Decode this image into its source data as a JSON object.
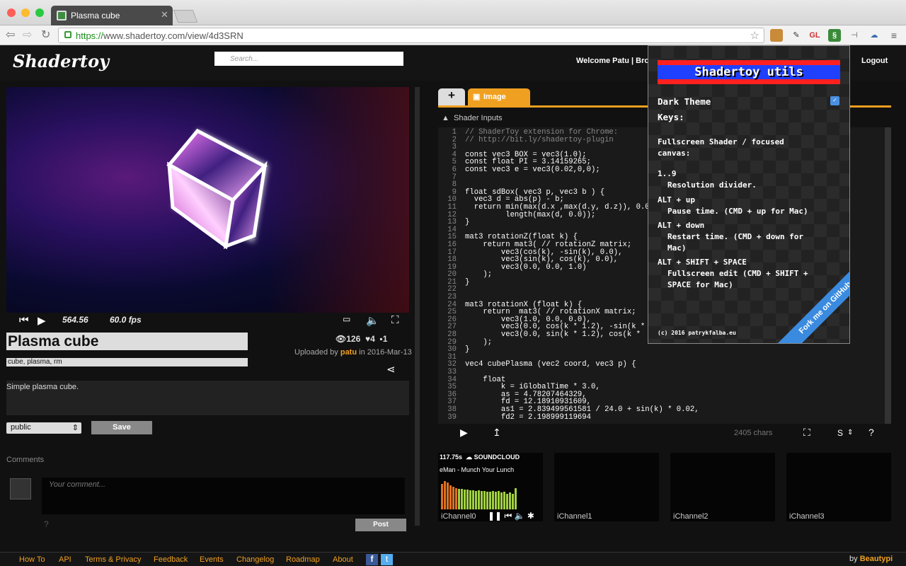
{
  "browser": {
    "tab_title": "Plasma cube",
    "url_scheme": "https://",
    "url_rest": "www.shadertoy.com/view/4d3SRN",
    "ext_gl": "GL"
  },
  "site": {
    "logo": "Shadertoy",
    "search_placeholder": "Search...",
    "welcome": "Welcome Patu |  Bro",
    "logout": "Logout"
  },
  "player": {
    "time": "564.56",
    "fps": "60.0 fps"
  },
  "shader": {
    "title": "Plasma cube",
    "tags": "cube, plasma, rm",
    "views": "126",
    "likes": "4",
    "comments_count": "1",
    "uploaded_prefix": "Uploaded by",
    "author": "patu",
    "uploaded_suffix": "in 2016-Mar-13",
    "description": "Simple plasma cube.",
    "visibility": "public",
    "save_label": "Save"
  },
  "comments": {
    "label": "Comments",
    "placeholder": "Your comment...",
    "question": "?",
    "post_label": "Post"
  },
  "editor": {
    "plus_tab": "+",
    "image_tab": "Image",
    "inputs_label": "Shader Inputs",
    "chars": "2405 chars",
    "font_size": "S",
    "help": "?",
    "line_numbers": [
      "1",
      "2",
      "3",
      "4",
      "5",
      "6",
      "7",
      "8",
      "9",
      "10",
      "11",
      "12",
      "13",
      "14",
      "15",
      "16",
      "17",
      "18",
      "19",
      "20",
      "21",
      "22",
      "23",
      "24",
      "25",
      "26",
      "27",
      "28",
      "29",
      "30",
      "31",
      "32",
      "33",
      "34",
      "35",
      "36",
      "37",
      "38",
      "39"
    ],
    "code_lines": [
      "// ShaderToy extension for Chrome:",
      "// http://bit.ly/shadertoy-plugin",
      "",
      "const vec3 BOX = vec3(1.0);",
      "const float PI = 3.14159265;",
      "const vec3 e = vec3(0.02,0,0);",
      "",
      "",
      "float sdBox( vec3 p, vec3 b ) {",
      "  vec3 d = abs(p) - b;",
      "  return min(max(d.x ,max(d.y, d.z)), 0.0",
      "         length(max(d, 0.0));",
      "}",
      "",
      "mat3 rotationZ(float k) {",
      "    return mat3( // rotationZ matrix;",
      "        vec3(cos(k), -sin(k), 0.0),",
      "        vec3(sin(k), cos(k), 0.0),",
      "        vec3(0.0, 0.0, 1.0)",
      "    );",
      "}",
      "",
      "",
      "mat3 rotationX (float k) {",
      "    return  mat3( // rotationX matrix;",
      "        vec3(1.0, 0.0, 0.0),",
      "        vec3(0.0, cos(k * 1.2), -sin(k *",
      "        vec3(0.0, sin(k * 1.2), cos(k *",
      "    );",
      "}",
      "",
      "vec4 cubePlasma (vec2 coord, vec3 p) {",
      "",
      "    float",
      "        k = iGlobalTime * 3.0,",
      "        as = 4.78207464329,",
      "        fd = 12.18910931609,",
      "        as1 = 2.839499561581 / 24.0 + sin(k) * 0.02,",
      "        fd2 = 2.198999119694"
    ]
  },
  "channels": {
    "ch0_time": "117.75s",
    "ch0_service": "SOUNDCLOUD",
    "ch0_track": "eMan - Munch Your Lunch",
    "labels": [
      "iChannel0",
      "iChannel1",
      "iChannel2",
      "iChannel3"
    ]
  },
  "popup": {
    "title": "Shadertoy utils",
    "dark_theme": "Dark Theme",
    "keys": "Keys:",
    "fs_title": "Fullscreen Shader / focused",
    "fs_title2": "canvas:",
    "k1": "1..9",
    "k1d": "Resolution divider.",
    "k2": "ALT + up",
    "k2d": "Pause time. (CMD + up for Mac)",
    "k3": "ALT + down",
    "k3d": "Restart time. (CMD + down for",
    "k3d2": "Mac)",
    "k4": "ALT + SHIFT + SPACE",
    "k4d": "Fullscreen edit (CMD + SHIFT +",
    "k4d2": "SPACE for Mac)",
    "ribbon": "Fork me on GitHub",
    "copyright": "(c) 2016 patrykfalba.eu"
  },
  "footer": {
    "links": [
      "How To",
      "API",
      "Terms & Privacy",
      "Feedback",
      "Events",
      "Changelog",
      "Roadmap",
      "About"
    ],
    "by_prefix": "by",
    "by_name": "Beautypi"
  },
  "colors": {
    "accent": "#f0a020",
    "ribbon": "#3a8be0"
  }
}
